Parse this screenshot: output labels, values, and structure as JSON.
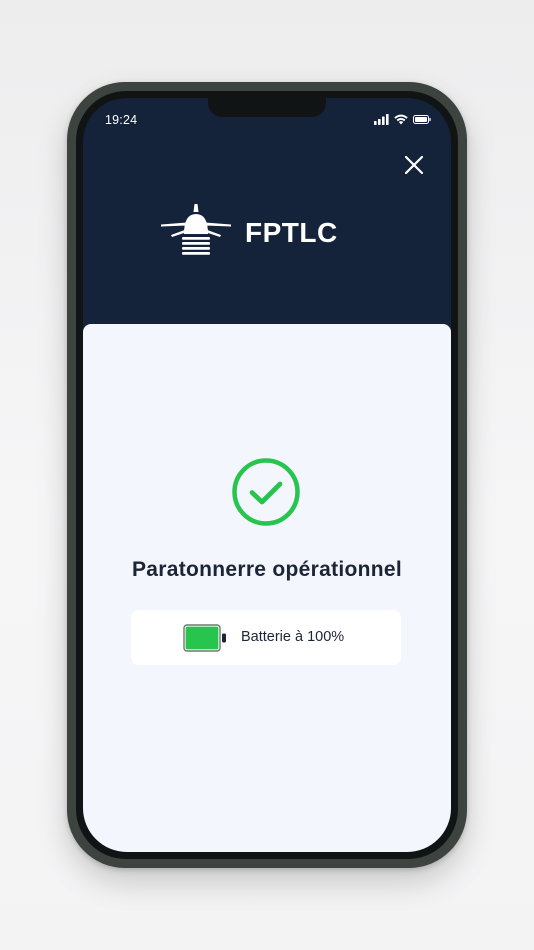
{
  "status_bar": {
    "time": "19:24",
    "icons": [
      "signal-icon",
      "wifi-icon",
      "battery-status-icon"
    ]
  },
  "header": {
    "close_icon": "close-icon",
    "brand_name": "FPTLC",
    "logo_icon": "lightning-rod-logo-icon"
  },
  "status": {
    "icon": "check-circle-icon",
    "title": "Paratonnerre opérationnel"
  },
  "battery": {
    "label": "Batterie à 100%",
    "level": 1.0,
    "icon": "battery-icon"
  },
  "colors": {
    "header_bg": "#14233a",
    "card_bg": "#f4f6fd",
    "success_green": "#27c44e",
    "text_dark": "#1c2536"
  }
}
